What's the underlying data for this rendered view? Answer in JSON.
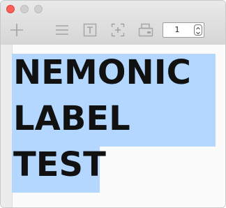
{
  "toolbar": {
    "icons": [
      "add-icon",
      "menu-icon",
      "text-icon",
      "frame-icon",
      "print-icon"
    ],
    "stepper_value": "1"
  },
  "label": {
    "lines": [
      "NEMONIC",
      "LABEL",
      "TEST"
    ]
  },
  "colors": {
    "selection": "#b3d7ff",
    "close": "#fe5f57"
  }
}
